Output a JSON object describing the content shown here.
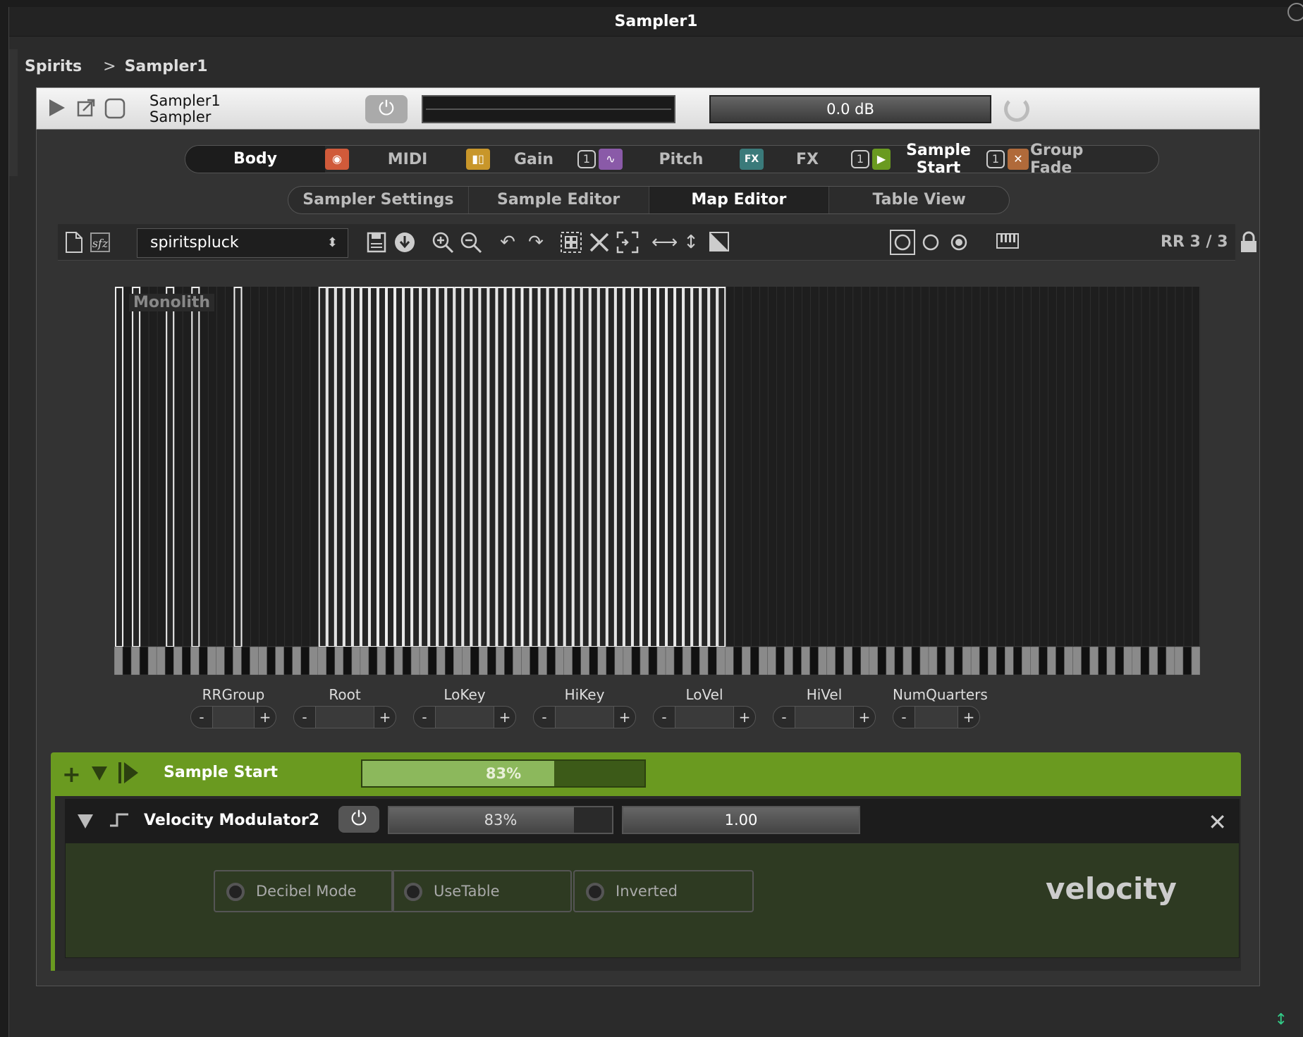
{
  "window": {
    "title": "Sampler1"
  },
  "breadcrumb": {
    "parent": "Spirits",
    "separator": ">",
    "current": "Sampler1"
  },
  "header": {
    "name": "Sampler1",
    "type": "Sampler",
    "gain": "0.0 dB"
  },
  "chains": [
    {
      "label": "Body"
    },
    {
      "label": "MIDI",
      "badge": "◉",
      "badge_color": "#d05a3a"
    },
    {
      "label": "Gain",
      "badge": "▮▯",
      "badge_color": "#c8962a"
    },
    {
      "label": "Pitch",
      "badge": "∿",
      "badge_color": "#8a5aa8",
      "count": "1"
    },
    {
      "label": "FX",
      "badge": "FX",
      "badge_color": "#3a7a7a"
    },
    {
      "label": "Sample Start",
      "badge": "▶",
      "badge_color": "#6a9a20",
      "count": "1"
    },
    {
      "label": "Group Fade",
      "badge": "✕",
      "badge_color": "#b06a3a",
      "count": "1"
    }
  ],
  "subtabs": [
    "Sampler Settings",
    "Sample Editor",
    "Map Editor",
    "Table View"
  ],
  "toolbar": {
    "sfz": "sfz",
    "preset": "spiritspluck",
    "rr": "RR 3 / 3"
  },
  "map": {
    "group_label": "Monolith"
  },
  "params": [
    "RRGroup",
    "Root",
    "LoKey",
    "HiKey",
    "LoVel",
    "HiVel",
    "NumQuarters"
  ],
  "modulator": {
    "title": "Sample Start",
    "value_text": "83%",
    "value": 0.83,
    "child": {
      "title": "Velocity Modulator2",
      "intensity_text": "83%",
      "intensity": 0.83,
      "value_text": "1.00",
      "value": 1.0,
      "toggles": [
        "Decibel Mode",
        "UseTable",
        "Inverted"
      ],
      "caption": "velocity"
    }
  },
  "colors": {
    "accent_green": "#6a9a20",
    "panel": "#333333"
  }
}
